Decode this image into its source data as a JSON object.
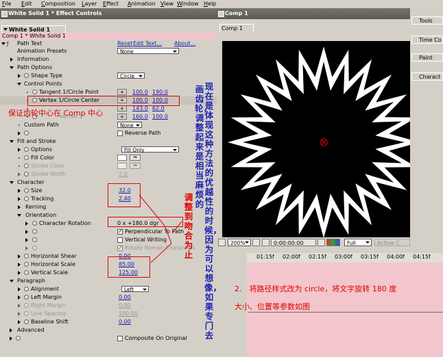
{
  "menu": [
    "File",
    "Edit",
    "Composition",
    "Layer",
    "Effect",
    "Animation",
    "View",
    "Window",
    "Help"
  ],
  "effect_controls": {
    "title": "White Solid 1 * Effect Controls",
    "tab": "White Solid 1",
    "subtitle": "Comp 1 * White Solid 1",
    "path_text": "Path Text",
    "reset": "Reset",
    "edit_text": "Edit Text...",
    "about": "About...",
    "animation_presets": "Animation Presets",
    "presets_value": "None",
    "information": "Information",
    "path_options": "Path Options",
    "shape_type": "Shape Type",
    "shape_type_value": "Circle",
    "control_points": "Control Points",
    "tangent": "Tangent 1/Circle Point",
    "tangent_x": "100.0",
    "tangent_y": "190.0",
    "vertex1": "Vertex 1/Circle Center",
    "vertex1_x": "100.0",
    "vertex1_y": "100.0",
    "tangent2_x": "143.0",
    "tangent2_y": "62.0",
    "vertex2": "Vertex 2",
    "vertex2_x": "160.0",
    "vertex2_y": "100.0",
    "custom_path": "Custom Path",
    "custom_path_value": "None",
    "reverse_path": "Reverse Path",
    "fill_and_stroke": "Fill and Stroke",
    "options": "Options",
    "options_value": "Fill Only",
    "fill_color": "Fill Color",
    "stroke_color": "Stroke Color",
    "stroke_width": "Stroke Width",
    "stroke_width_value": "2.0",
    "character": "Character",
    "size": "Size",
    "size_value": "32.0",
    "tracking": "Tracking",
    "tracking_value": "2.40",
    "kerning": "Kerning",
    "orientation": "Orientation",
    "character_rotation": "Character Rotation",
    "character_rotation_value": "0 x +180.0 dgr",
    "perpendicular": "Perpendicular To Path",
    "vertical_writing": "Vertical Writing",
    "rotate_roman": "Rotate Roman Characters",
    "horizontal_shear": "Horizontal Shear",
    "horizontal_shear_value": "0.00",
    "horizontal_scale": "Horizontal Scale",
    "horizontal_scale_value": "85.00",
    "vertical_scale": "Vertical Scale",
    "vertical_scale_value": "125.00",
    "paragraph": "Paragraph",
    "alignment": "Alignment",
    "alignment_value": "Left",
    "left_margin": "Left Margin",
    "left_margin_value": "0.00",
    "right_margin": "Right Margin",
    "right_margin_value": "0.00",
    "line_spacing": "Line Spacing",
    "line_spacing_value": "100.00",
    "baseline_shift": "Baseline Shift",
    "baseline_shift_value": "0.00",
    "advanced": "Advanced",
    "composite_on_original": "Composite On Original"
  },
  "annotations": {
    "center_note": "保证齿轮中心在 Comp 中心",
    "column_a": "现在是体现这种方法的优越性的时候，因为可以想像，如果专门去",
    "column_b": "画齿轮，调整起来是相当麻烦的",
    "column_c": "调整到吻合为止",
    "step_note": "2.　将路径样式改为 circle，将文字旋转 180 度",
    "step_note2": "大小、位置等参数如图"
  },
  "composition": {
    "title": "Comp 1",
    "tab": "Comp 1",
    "zoom": "200%",
    "timecode": "0:00:00:00",
    "resolution": "Full",
    "camera": "Active C"
  },
  "timeline": {
    "ticks": [
      "01:15f",
      "02:00f",
      "02:15f",
      "03:00f",
      "03:15f",
      "04:00f",
      "04:15f"
    ]
  },
  "side_panels": [
    "Tools",
    "Time Co",
    "Paint",
    "Charact"
  ],
  "colors": {
    "title_bar": "#5a5a54",
    "subtitle_bar": "#f2c6cc",
    "value_link": "#1a1aa8",
    "annotation_red": "#e00000",
    "annotation_blue": "#1e22b4"
  },
  "gear": {
    "teeth": 24,
    "fill": "white",
    "background": "black"
  }
}
